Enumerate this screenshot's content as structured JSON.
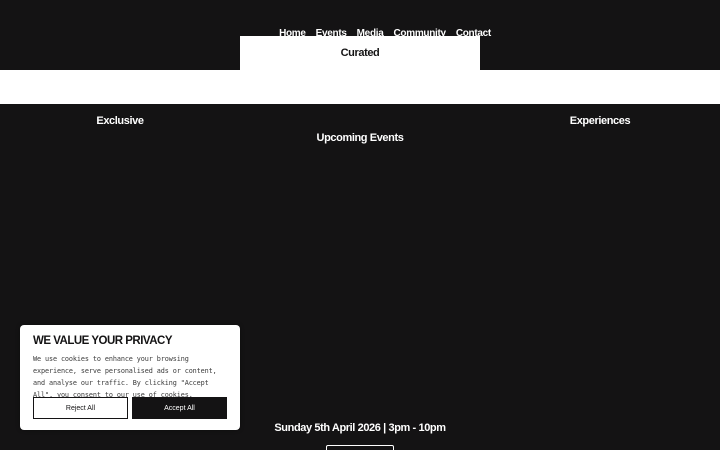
{
  "nav": {
    "items": [
      {
        "label": "Home"
      },
      {
        "label": "Events"
      },
      {
        "label": "Media"
      },
      {
        "label": "Community"
      },
      {
        "label": "Contact"
      }
    ]
  },
  "hero": {
    "word_center": "Curated",
    "word_left": "Exclusive",
    "word_right": "Experiences"
  },
  "events": {
    "heading": "Upcoming Events",
    "date": "Sunday 5th April 2026 | 3pm - 10pm"
  },
  "cookie_banner": {
    "title": "WE VALUE YOUR PRIVACY",
    "body": "We use cookies to enhance your browsing experience, serve personalised ads or content, and analyse our traffic. By clicking \"Accept All\", you consent to our use of cookies.",
    "reject_label": "Reject All",
    "accept_label": "Accept All"
  },
  "colors": {
    "background": "#141314",
    "foreground": "#ffffff"
  }
}
